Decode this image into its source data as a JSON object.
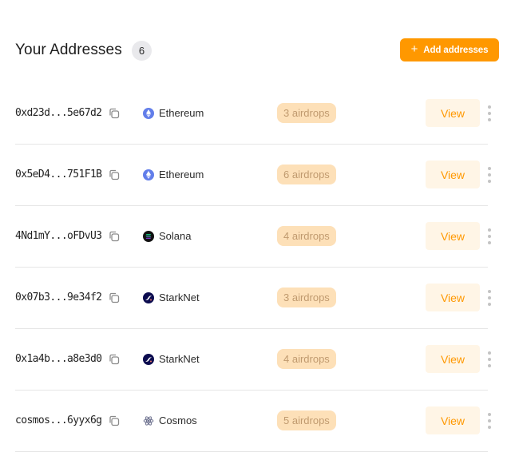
{
  "header": {
    "title": "Your Addresses",
    "count": "6",
    "add_button_icon": "+",
    "add_button_label": "Add addresses"
  },
  "colors": {
    "accent": "#ff9800",
    "airdrop_badge_bg": "#fde0b8",
    "view_button_bg": "#fff5e6"
  },
  "addresses": [
    {
      "address": "0xd23d...5e67d2",
      "chain": "Ethereum",
      "chain_icon": "ethereum-icon",
      "airdrops": "3 airdrops",
      "view_label": "View"
    },
    {
      "address": "0x5eD4...751F1B",
      "chain": "Ethereum",
      "chain_icon": "ethereum-icon",
      "airdrops": "6 airdrops",
      "view_label": "View"
    },
    {
      "address": "4Nd1mY...oFDvU3",
      "chain": "Solana",
      "chain_icon": "solana-icon",
      "airdrops": "4 airdrops",
      "view_label": "View"
    },
    {
      "address": "0x07b3...9e34f2",
      "chain": "StarkNet",
      "chain_icon": "starknet-icon",
      "airdrops": "3 airdrops",
      "view_label": "View"
    },
    {
      "address": "0x1a4b...a8e3d0",
      "chain": "StarkNet",
      "chain_icon": "starknet-icon",
      "airdrops": "4 airdrops",
      "view_label": "View"
    },
    {
      "address": "cosmos...6yyx6g",
      "chain": "Cosmos",
      "chain_icon": "cosmos-icon",
      "airdrops": "5 airdrops",
      "view_label": "View"
    }
  ]
}
